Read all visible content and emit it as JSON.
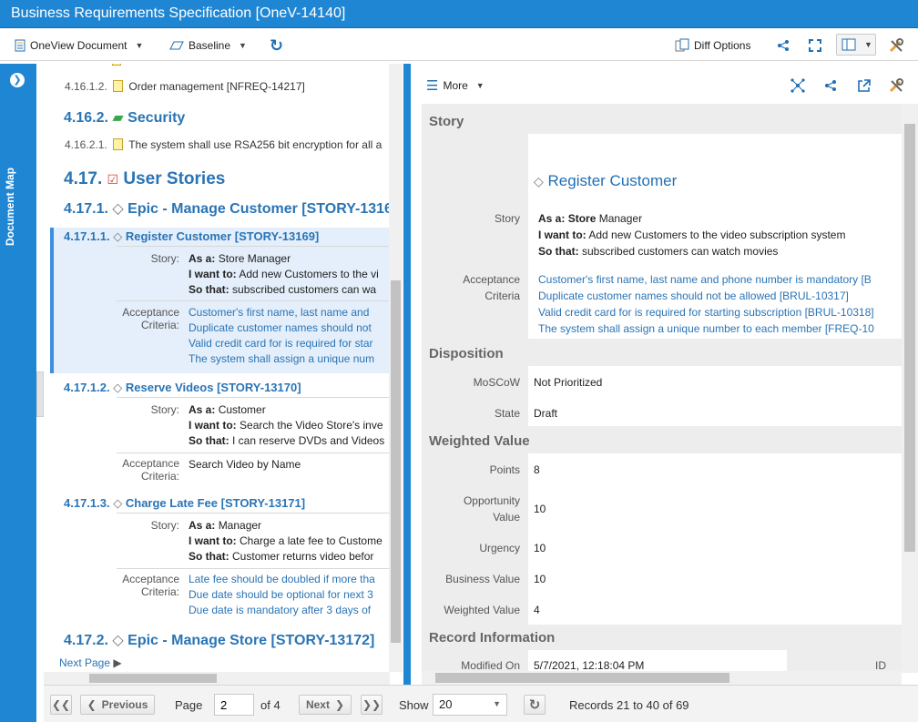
{
  "window": {
    "title": "Business Requirements Specification [OneV-14140]"
  },
  "toolbar": {
    "view_label": "OneView Document",
    "baseline_label": "Baseline",
    "diff_label": "Diff Options"
  },
  "left_rail": {
    "label": "Document Map"
  },
  "doc": {
    "rows": {
      "r1_num": "4.16.1.2.",
      "r1_text": "Order management [NFREQ-14217]",
      "r2_num": "4.16.2.",
      "r2_text": "Security",
      "r3_num": "4.16.2.1.",
      "r3_text": "The system shall use RSA256 bit encryption for all a",
      "r4_num": "4.17.",
      "r4_text": "User Stories",
      "r5_num": "4.17.1.",
      "r5_text": "Epic - Manage Customer [STORY-1316",
      "r6_num": "4.17.1.1.",
      "r6_text": "Register Customer [STORY-13169]",
      "r7_num": "4.17.1.2.",
      "r7_text": "Reserve Videos [STORY-13170]",
      "r8_num": "4.17.1.3.",
      "r8_text": "Charge Late Fee [STORY-13171]",
      "r9_num": "4.17.2.",
      "r9_text": "Epic - Manage Store [STORY-13172]"
    },
    "labels": {
      "story": "Story:",
      "acc1": "Acceptance",
      "acc2": "Criteria:"
    },
    "kw": {
      "as_a": "As a:",
      "want": "I want to:",
      "so": "So that:"
    },
    "s1": {
      "as": "Store",
      "as_rest": " Manager",
      "want": "Add new Customers to the vi",
      "so": "subscribed customers can wa",
      "c1": "Customer's first name, last name and",
      "c2": "Duplicate customer names should not",
      "c3": "Valid credit card for is required for star",
      "c4": "The system shall assign a unique num"
    },
    "s2": {
      "as": "Customer",
      "want": "Search the Video Store's inve",
      "so": "I can reserve DVDs and Videos",
      "c1": "Search Video by Name"
    },
    "s3": {
      "as": "Manager",
      "want": "Charge a late fee to Custome",
      "so": "Customer returns video befor",
      "c1": "Late fee should be doubled if more tha",
      "c2": "Due date should be optional for next 3",
      "c3": "Due date is mandatory after 3 days of"
    },
    "next_page": "Next Page"
  },
  "right": {
    "more": "More",
    "sections": {
      "story": "Story",
      "disposition": "Disposition",
      "weighted": "Weighted Value",
      "record": "Record Information"
    },
    "title": "Register Customer",
    "labels": {
      "story": "Story",
      "acc1": "Acceptance",
      "acc2": "Criteria",
      "moscow": "MoSCoW",
      "state": "State",
      "points": "Points",
      "opp1": "Opportunity",
      "opp2": "Value",
      "urgency": "Urgency",
      "business": "Business Value",
      "weighted": "Weighted Value",
      "modified": "Modified On",
      "id": "ID"
    },
    "story": {
      "as_a": "As a:",
      "as_bold": "Store",
      "as_rest": " Manager",
      "want_kw": "I want to:",
      "want": " Add new Customers to the video subscription system",
      "so_kw": "So that:",
      "so": " subscribed customers can watch movies"
    },
    "criteria": [
      "Customer's first name, last name and phone number is mandatory [B",
      "Duplicate customer names should not be allowed [BRUL-10317]",
      "Valid credit card for is required for starting subscription [BRUL-10318]",
      "The system shall assign a unique number to each member [FREQ-10"
    ],
    "values": {
      "moscow": "Not Prioritized",
      "state": "Draft",
      "points": "8",
      "opportunity": "10",
      "urgency": "10",
      "business": "10",
      "weighted": "4",
      "modified": "5/7/2021, 12:18:04 PM"
    }
  },
  "pager": {
    "previous": "Previous",
    "page_label": "Page",
    "page_value": "2",
    "of": "of 4",
    "next": "Next",
    "show": "Show",
    "show_value": "20",
    "records": "Records 21 to 40 of 69"
  }
}
